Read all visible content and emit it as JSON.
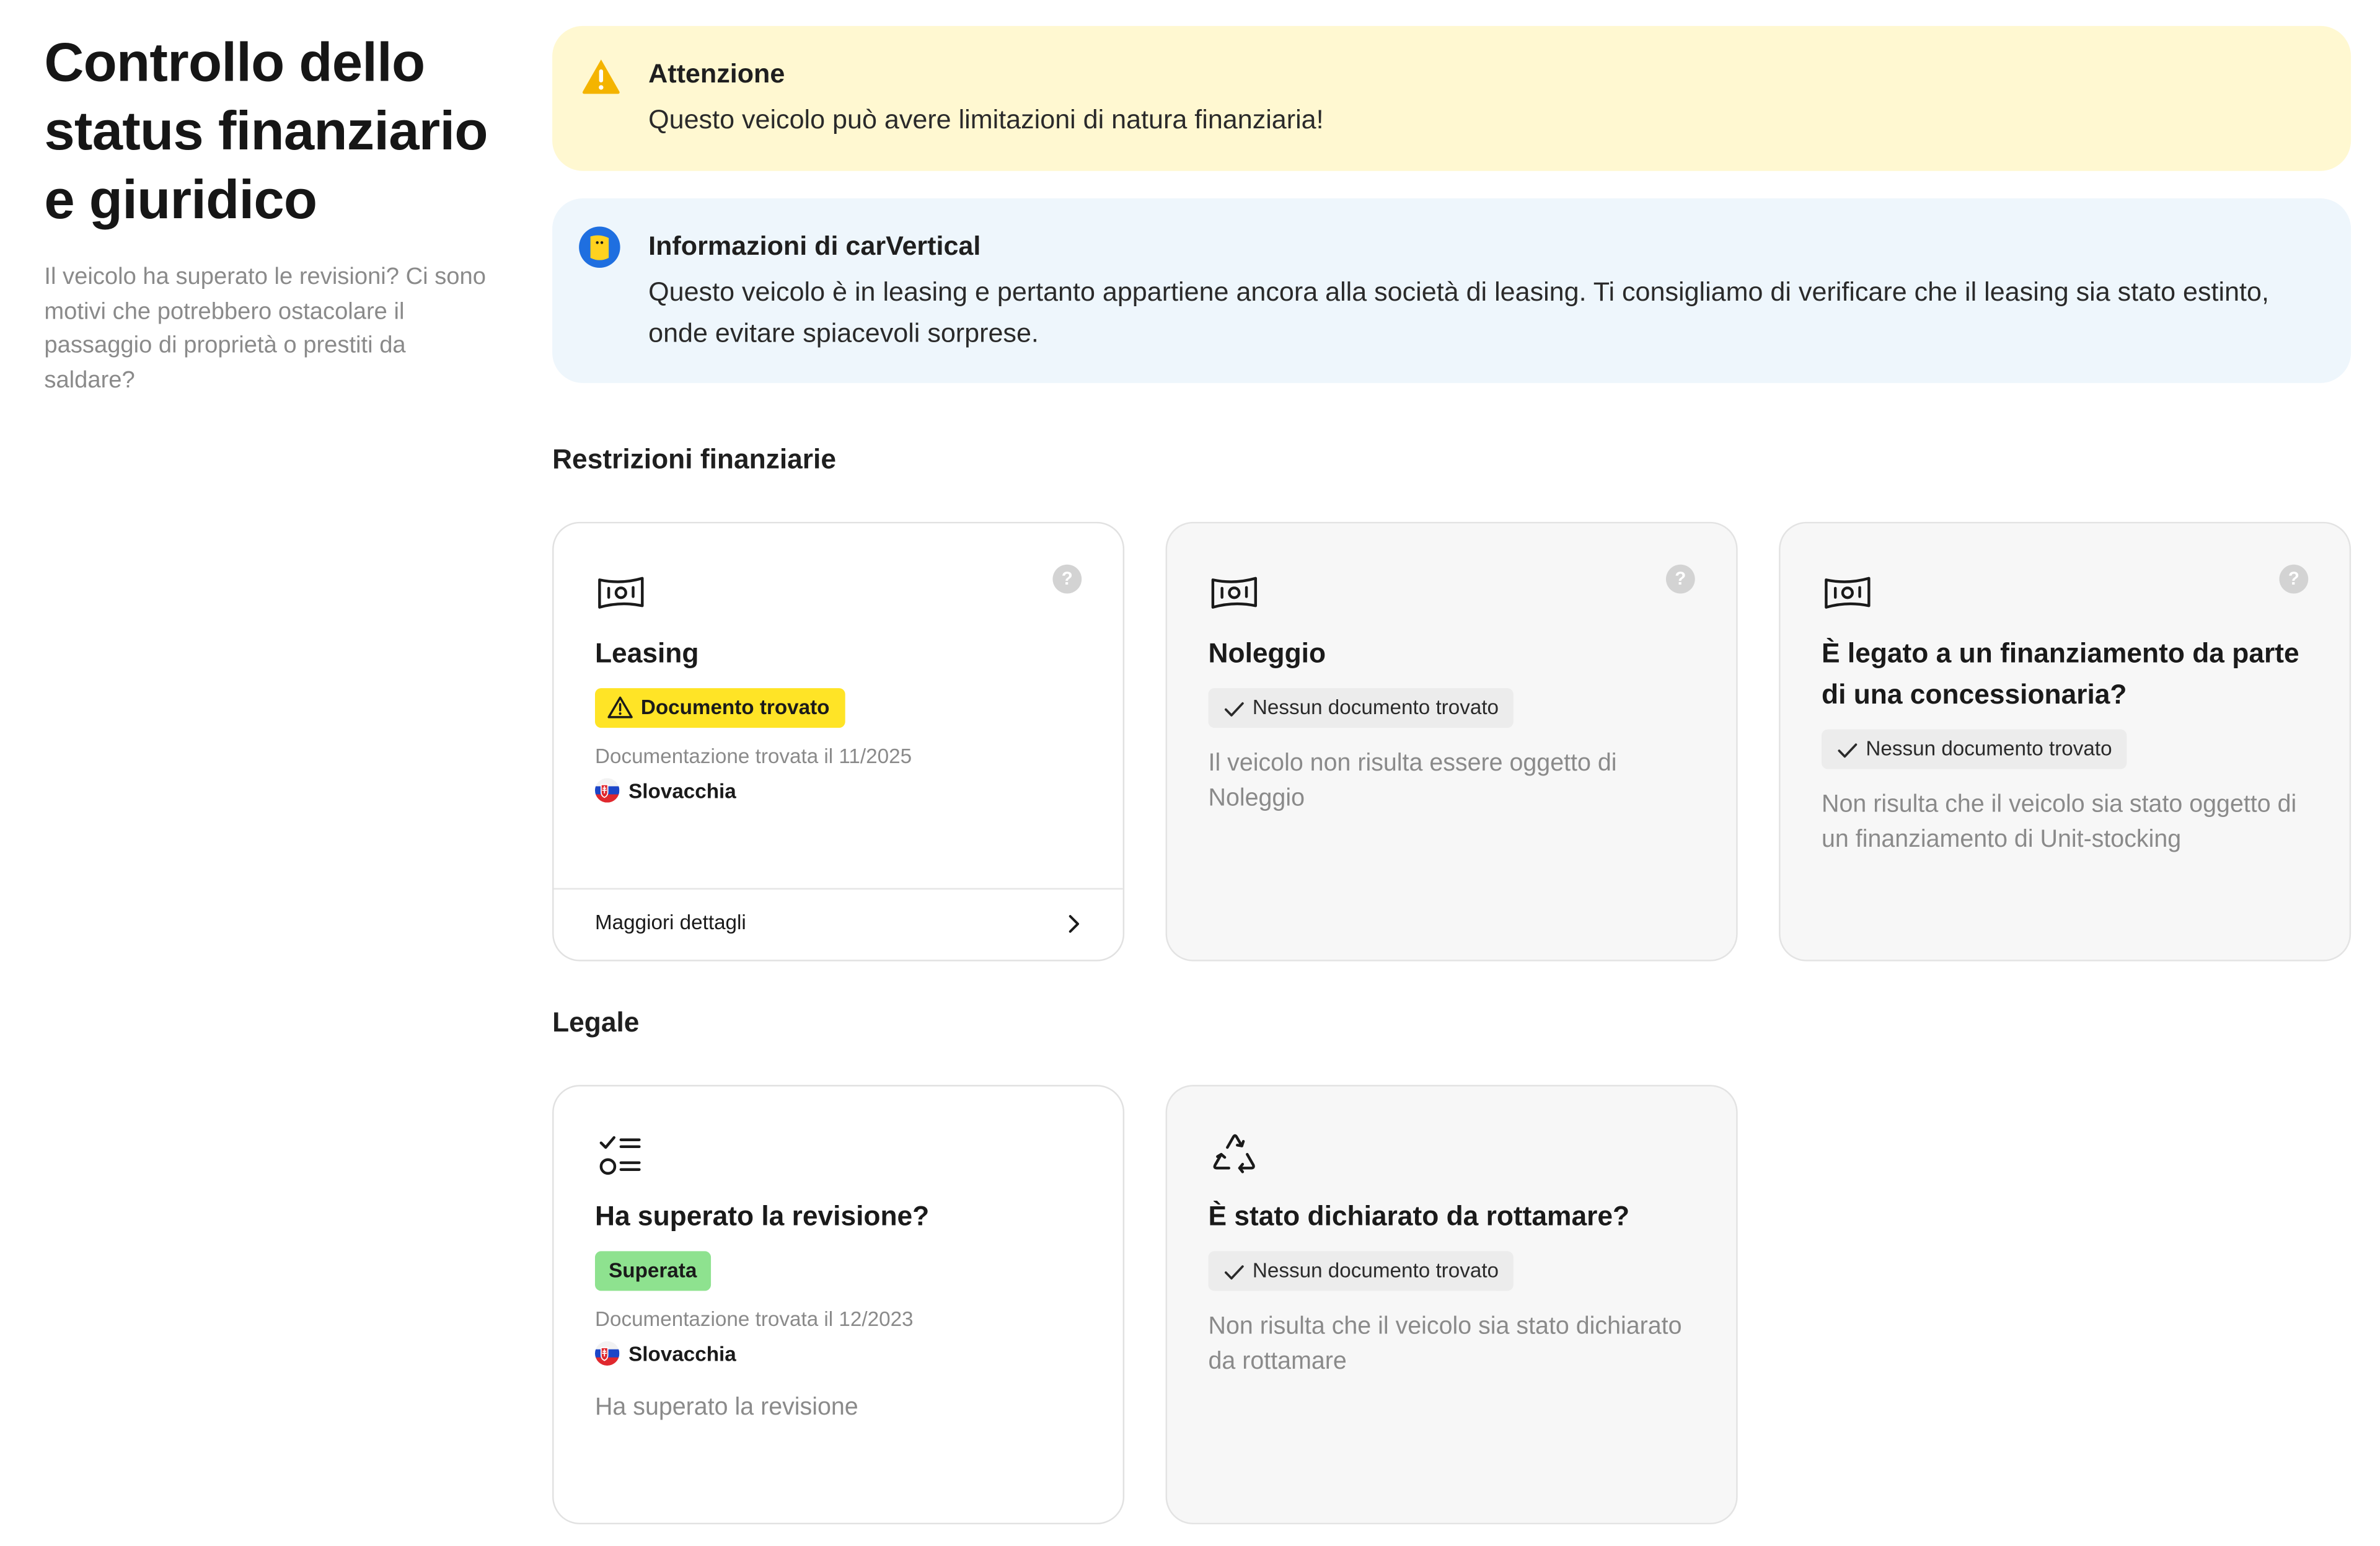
{
  "sidebar": {
    "title": "Controllo dello status finanziario e giuridico",
    "description": "Il veicolo ha superato le revisioni? Ci sono motivi che potrebbero ostacolare il passaggio di proprietà o prestiti da saldare?"
  },
  "alerts": {
    "warning": {
      "icon": "warning-triangle-icon",
      "title": "Attenzione",
      "text": "Questo veicolo può avere limitazioni di natura finanziaria!"
    },
    "info": {
      "icon": "carvertical-logo-icon",
      "title": "Informazioni di carVertical",
      "text": "Questo veicolo è in leasing e pertanto appartiene ancora alla società di leasing. Ti consigliamo di verificare che il leasing sia stato estinto, onde evitare spiacevoli sorprese."
    }
  },
  "financial": {
    "section_title": "Restrizioni finanziarie",
    "cards": [
      {
        "icon": "banknote-icon",
        "title": "Leasing",
        "badge": "Documento trovato",
        "badge_color": "#ffe426",
        "doc_date": "Documentazione trovata il 11/2025",
        "country": "Slovacchia",
        "footer_link": "Maggiori dettagli"
      },
      {
        "icon": "banknote-icon",
        "title": "Noleggio",
        "badge": "Nessun documento trovato",
        "desc": "Il veicolo non risulta essere oggetto di Noleggio"
      },
      {
        "icon": "banknote-icon",
        "title": "È legato a un finanziamento da parte di una concessionaria?",
        "badge": "Nessun documento trovato",
        "desc": "Non risulta che il veicolo sia stato oggetto di un finanziamento di Unit-stocking"
      }
    ]
  },
  "legal": {
    "section_title": "Legale",
    "cards": [
      {
        "icon": "checklist-icon",
        "title": "Ha superato la revisione?",
        "badge": "Superata",
        "badge_color": "#8ee28f",
        "doc_date": "Documentazione trovata il 12/2023",
        "country": "Slovacchia",
        "desc": "Ha superato la revisione"
      },
      {
        "icon": "recycle-icon",
        "title": "È stato dichiarato da rottamare?",
        "badge": "Nessun documento trovato",
        "desc": "Non risulta che il veicolo sia stato dichiarato da rottamare"
      }
    ]
  },
  "help_label": "?"
}
